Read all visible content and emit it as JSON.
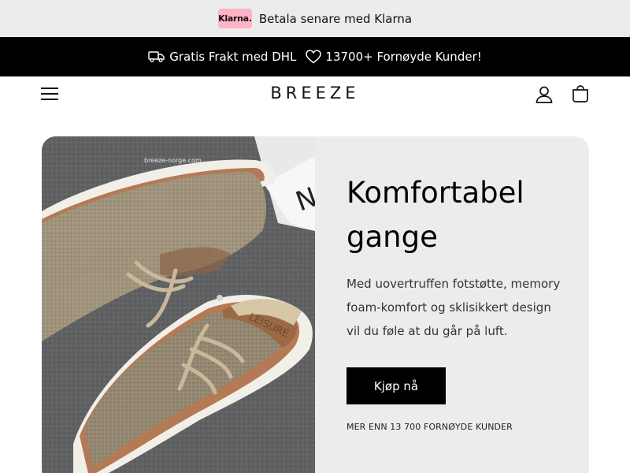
{
  "announcement": {
    "badge": "Klarna.",
    "text": "Betala senare med Klarna"
  },
  "promo_bar": {
    "shipping_icon": "truck-icon",
    "shipping_text": "Gratis Frakt med DHL",
    "customers_icon": "heart-icon",
    "customers_text": "13700+ Fornøyde Kunder!"
  },
  "header": {
    "logo": "BREEZE",
    "menu_icon": "hamburger-menu-icon",
    "account_icon": "user-icon",
    "cart_icon": "shopping-bag-icon"
  },
  "hero": {
    "image_watermark": "breeze-norge.com",
    "shoe_label": "LEISURE",
    "title_line1": "Komfortabel",
    "title_line2": "gange",
    "description": "Med uovertruffen fotstøtte, memory foam-komfort og sklisikkert design vil du føle at du går på luft.",
    "cta_label": "Kjøp nå",
    "note": "MER ENN 13 700 FORNØYDE KUNDER"
  },
  "colors": {
    "announce_bg": "#ececec",
    "promo_bg": "#000000",
    "klarna_pink": "#ffb3c7",
    "hero_bg": "#ececec",
    "button_bg": "#000000"
  }
}
